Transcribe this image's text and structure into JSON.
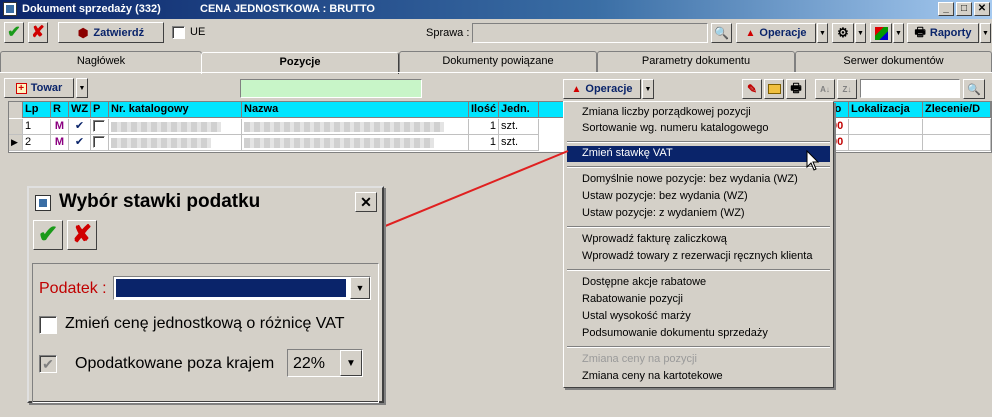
{
  "window": {
    "title": "Dokument sprzedaży (332)",
    "subtitle": "CENA JEDNOSTKOWA : BRUTTO"
  },
  "toolbar": {
    "approve_label": "Zatwierdź",
    "ue_label": "UE",
    "sprawa_label": "Sprawa :",
    "sprawa_value": "",
    "operacje_label": "Operacje",
    "raporty_label": "Raporty"
  },
  "tabs": [
    {
      "label": "Nagłówek"
    },
    {
      "label": "Pozycje"
    },
    {
      "label": "Dokumenty powiązane"
    },
    {
      "label": "Parametry dokumentu"
    },
    {
      "label": "Serwer dokumentów"
    }
  ],
  "positions": {
    "towar_label": "Towar",
    "operacje_label": "Operacje",
    "search_value": "",
    "columns": [
      "Lp",
      "R",
      "WZ",
      "P",
      "Nr. katalogowy",
      "Nazwa",
      "Ilość",
      "Jedn.",
      "to",
      "Lokalizacja",
      "Zlecenie/D"
    ],
    "rows": [
      {
        "lp": "1",
        "r": "M",
        "wz": "✔",
        "qty": "1",
        "unit": "szt.",
        "price": "00"
      },
      {
        "lp": "2",
        "r": "M",
        "wz": "✔",
        "qty": "1",
        "unit": "szt.",
        "price": "00"
      }
    ]
  },
  "menu": {
    "items": [
      {
        "label": "Zmiana liczby porządkowej pozycji",
        "state": "normal"
      },
      {
        "label": "Sortowanie wg. numeru katalogowego",
        "state": "normal"
      },
      {
        "label": "Zmień stawkę VAT",
        "state": "highlighted"
      },
      {
        "label": "Domyślnie nowe pozycje: bez wydania (WZ)",
        "state": "normal"
      },
      {
        "label": "Ustaw pozycje: bez wydania (WZ)",
        "state": "normal"
      },
      {
        "label": "Ustaw pozycje: z wydaniem (WZ)",
        "state": "normal"
      },
      {
        "label": "Wprowadź fakturę zaliczkową",
        "state": "normal"
      },
      {
        "label": "Wprowadź towary z rezerwacji ręcznych klienta",
        "state": "normal"
      },
      {
        "label": "Dostępne akcje rabatowe",
        "state": "normal"
      },
      {
        "label": "Rabatowanie pozycji",
        "state": "normal"
      },
      {
        "label": "Ustal wysokość marży",
        "state": "normal"
      },
      {
        "label": "Podsumowanie dokumentu sprzedaży",
        "state": "normal"
      },
      {
        "label": "Zmiana ceny na pozycji",
        "state": "disabled"
      },
      {
        "label": "Zmiana ceny na kartotekowe",
        "state": "normal"
      }
    ]
  },
  "dialog": {
    "title": "Wybór stawki podatku",
    "podatek_label": "Podatek :",
    "podatek_value": "",
    "change_price_label": "Zmień cenę jednostkową o różnicę VAT",
    "taxed_abroad_label": "Opodatkowane poza krajem",
    "rate_value": "22%"
  },
  "colors": {
    "accent": "#0a246a",
    "grid_header": "#00e5ff",
    "label_red": "#c00000",
    "arrow_red": "#e02020",
    "search_green": "#c8f5c8"
  }
}
